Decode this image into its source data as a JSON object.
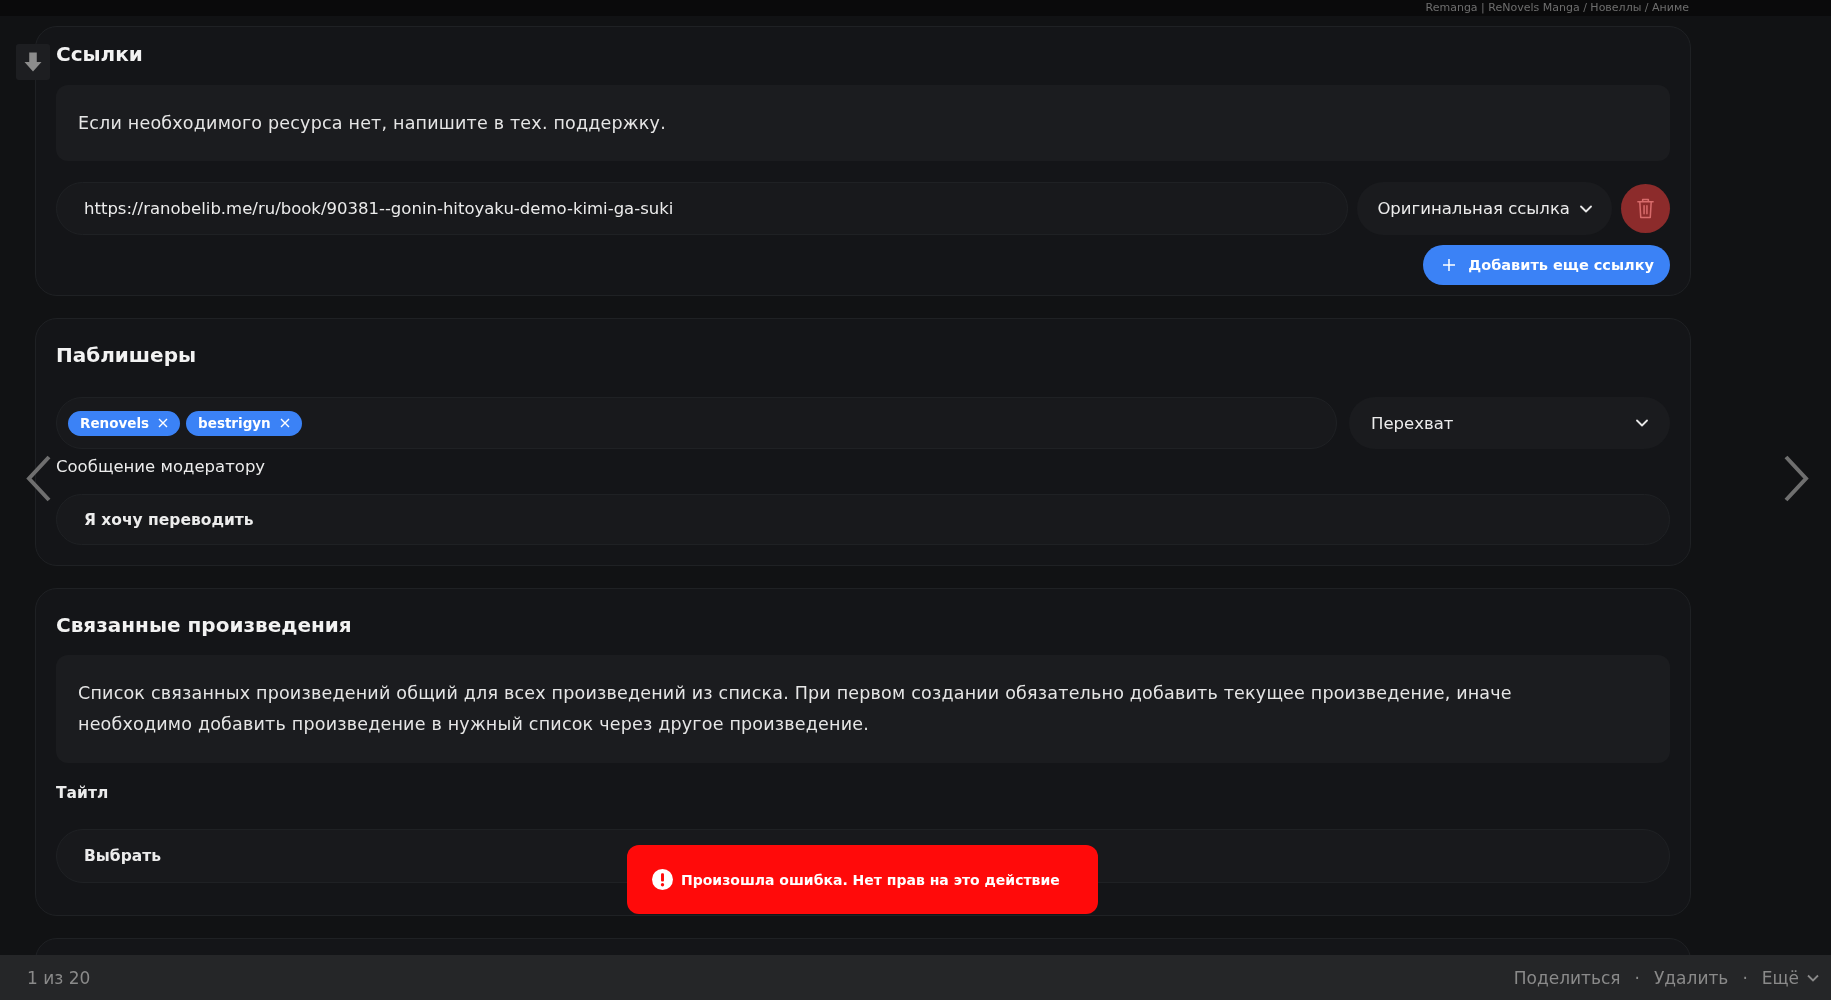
{
  "top_bar": {
    "title": "Remanga | ReNovels Manga / Новеллы / Аниме"
  },
  "links_section": {
    "title": "Ссылки",
    "notice": "Если необходимого ресурса нет, напишите в тех. поддержку.",
    "links": [
      {
        "url": "https://ranobelib.me/ru/book/90381--gonin-hitoyaku-demo-kimi-ga-suki",
        "type": "Оригинальная ссылка"
      }
    ],
    "add_button": "Добавить еще ссылку"
  },
  "publishers_section": {
    "title": "Паблишеры",
    "publishers": [
      {
        "label": "Renovels"
      },
      {
        "label": "bestrigyn"
      }
    ],
    "mode": "Перехват",
    "message_label": "Сообщение модератору",
    "message": "Я хочу переводить"
  },
  "related_section": {
    "title": "Связанные произведения",
    "notice": "Список связанных произведений общий для всех произведений из списка. При первом создании обязательно добавить текущее произведение, иначе необходимо добавить произведение в нужный список через другое произведение.",
    "title_label": "Тайтл",
    "title_select": "Выбрать"
  },
  "toast": {
    "kind": "error",
    "message": "Произошла ошибка. Нет прав на это действие"
  },
  "pager": {
    "position": "1 из 20",
    "separator": "·",
    "actions": [
      {
        "label": "Поделиться",
        "kind": "link"
      },
      {
        "label": "Удалить",
        "kind": "link"
      },
      {
        "label": "Ещё",
        "kind": "menu"
      }
    ]
  }
}
